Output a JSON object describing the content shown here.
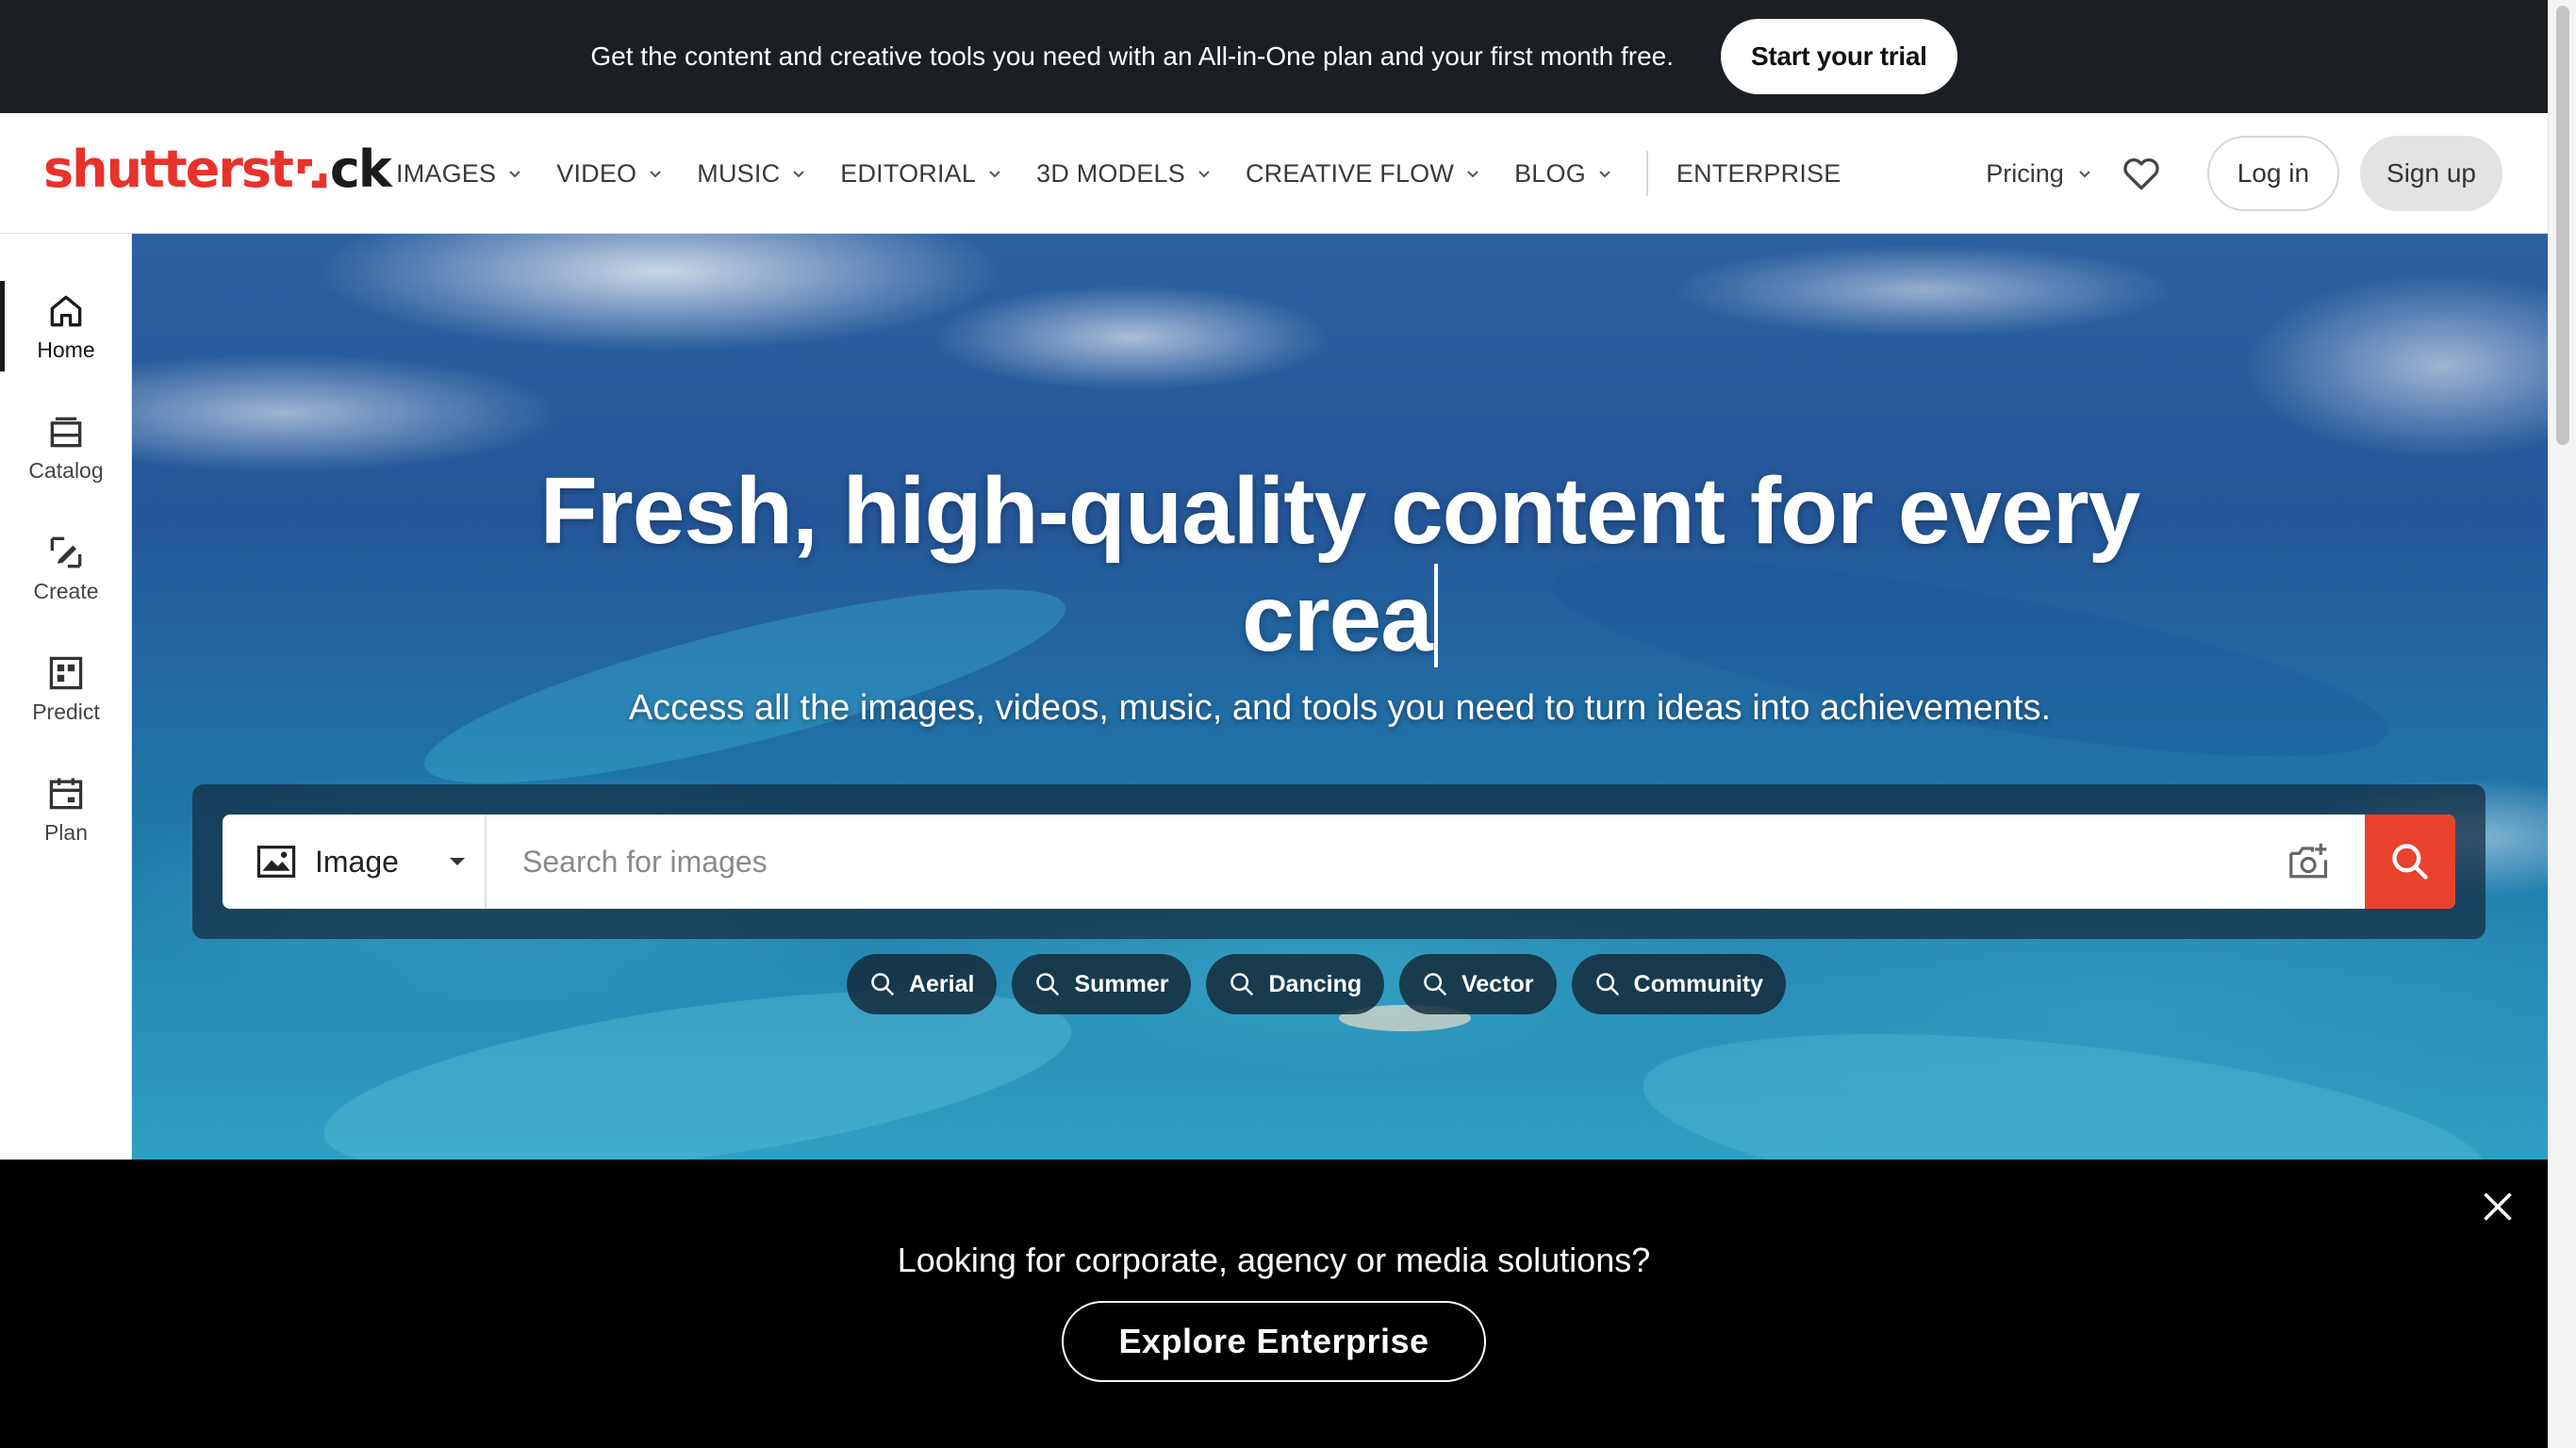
{
  "promo": {
    "text": "Get the content and creative tools you need with an All-in-One plan and your first month free.",
    "trial_label": "Start your trial"
  },
  "header": {
    "logo_part1": "shutterst",
    "logo_part2": "ck",
    "nav": [
      {
        "label": "IMAGES",
        "has_dropdown": true
      },
      {
        "label": "VIDEO",
        "has_dropdown": true
      },
      {
        "label": "MUSIC",
        "has_dropdown": true
      },
      {
        "label": "EDITORIAL",
        "has_dropdown": true
      },
      {
        "label": "3D MODELS",
        "has_dropdown": true
      },
      {
        "label": "CREATIVE FLOW",
        "has_dropdown": true
      },
      {
        "label": "BLOG",
        "has_dropdown": true
      },
      {
        "label": "ENTERPRISE",
        "has_dropdown": false
      }
    ],
    "pricing_label": "Pricing",
    "favorites_icon": "heart-icon",
    "login_label": "Log in",
    "signup_label": "Sign up"
  },
  "sidebar": {
    "items": [
      {
        "label": "Home",
        "icon": "home-icon",
        "active": true
      },
      {
        "label": "Catalog",
        "icon": "catalog-icon",
        "active": false
      },
      {
        "label": "Create",
        "icon": "create-icon",
        "active": false
      },
      {
        "label": "Predict",
        "icon": "predict-icon",
        "active": false
      },
      {
        "label": "Plan",
        "icon": "plan-icon",
        "active": false
      }
    ]
  },
  "hero": {
    "title_line1": "Fresh, high-quality content for every",
    "title_line2": "crea",
    "subtitle": "Access all the images, videos, music, and tools you need to turn ideas into achievements.",
    "search": {
      "type_label": "Image",
      "placeholder": "Search for images",
      "value": ""
    },
    "chips": [
      "Aerial",
      "Summer",
      "Dancing",
      "Vector",
      "Community"
    ]
  },
  "enterprise_banner": {
    "title": "Looking for corporate, agency or media solutions?",
    "button_label": "Explore Enterprise"
  },
  "colors": {
    "brand_red": "#e8322a",
    "promo_bg": "#1b1e22",
    "search_button": "#e8412c",
    "banner_bg": "#000000"
  }
}
